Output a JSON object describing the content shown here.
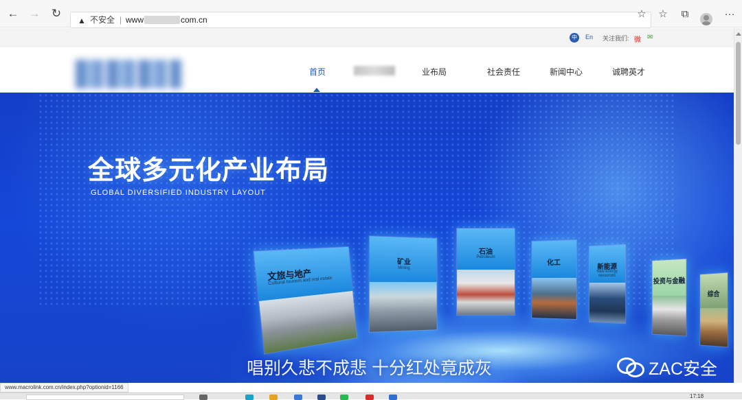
{
  "browser": {
    "back_icon": "←",
    "forward_icon": "→",
    "reload_icon": "↻",
    "warning_icon": "▲",
    "insecure_label": "不安全",
    "separator": "|",
    "url_prefix": "www",
    "url_suffix": "com.cn",
    "star_icon": "☆",
    "favorites_icon": "☆",
    "collections_icon": "⧉",
    "more_icon": "···"
  },
  "utility": {
    "lang_zh": "中",
    "lang_en": "En",
    "follow_label": "关注我们:",
    "weibo_icon": "微",
    "wechat_icon": "✉"
  },
  "header": {
    "nav": {
      "home": "首页",
      "industry_partial": "业布局",
      "social": "社会责任",
      "news": "新闻中心",
      "careers": "诚聘英才"
    },
    "active_color": "#1e5cb3"
  },
  "hero": {
    "title": "全球多元化产业布局",
    "subtitle": "GLOBAL DIVERSIFIED INDUSTRY LAYOUT",
    "caption": "唱别久悲不成悲 十分红处竟成灰",
    "watermark": "ZAC安全",
    "cards": [
      {
        "label": "文旅与地产",
        "sub": "Cultural tourism and real estate"
      },
      {
        "label": "矿业",
        "sub": "Mining"
      },
      {
        "label": "石油",
        "sub": "Petroleum"
      },
      {
        "label": "化工",
        "sub": ""
      },
      {
        "label": "新能源",
        "sub": "New energy resources"
      },
      {
        "label": "投资与金融",
        "sub": ""
      },
      {
        "label": "综合",
        "sub": ""
      }
    ],
    "colors": {
      "background": "#1547d8",
      "glow": "#b8f0ff",
      "text": "#ffffff"
    }
  },
  "status": {
    "url": "www.macrolink.com.cn/index.php?optionid=1166"
  },
  "taskbar": {
    "clock": "17:18"
  }
}
